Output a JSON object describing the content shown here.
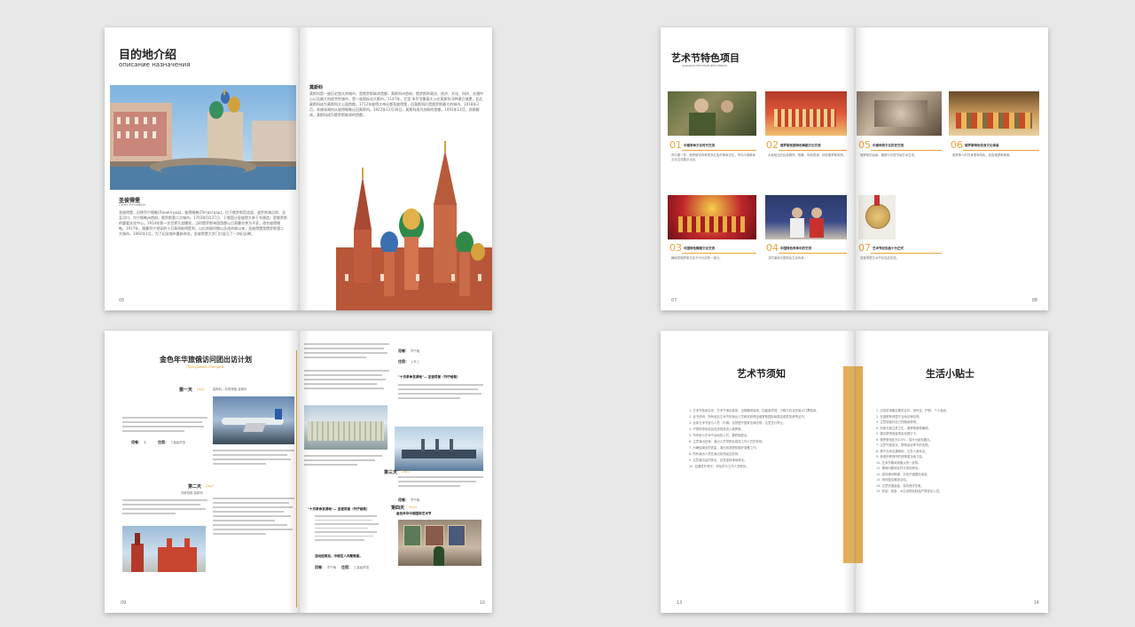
{
  "spread1": {
    "left": {
      "title": "目的地介绍",
      "subtitle": "описание назначения",
      "caption_title": "圣彼得堡",
      "caption_sub": "Санкт-Петербург",
      "body": "圣彼得堡，旧称列宁格勒(Ленинград)，彼得格勒(Петроград)，位于俄罗斯西北部，波罗的海沿岸，涅瓦河口，列宁格勒州首府，俄罗斯第二大城市。1703年5月27日，于俄国沙皇彼得大帝下令建造，是俄罗斯的重要文化中心。1914年第一次世界大战爆发，当时俄罗斯帝国首都以日耳曼名称为不妥，改名彼得格勒。1917年，随着列宁领导的十月革命取得胜利，以后苏联时期以及改苏联以来，圣彼得堡是俄罗斯第二大城市。1992年1月，为了纪念城市重新命名，圣彼得堡大学门口竖立了一块纪念碑。",
      "page_num": "05"
    },
    "right": {
      "heading": "莫斯科",
      "body": "莫斯科是一座历史悠久的城市，是俄罗斯联邦首都、莫斯科州首府，俄罗斯的政治、经济、文化、科技、交通中心以及最大的综合性城市，是一座国际化大都市。1147年，尤里·多尔戈鲁基大公在莫斯科河畔建立城堡，此后莫斯科成为莫斯科大公国首都。1712年彼得大帝迁都圣彼得堡，但莫斯科仍是俄罗斯最大的城市。1918年3月，苏维埃政府从彼得格勒迁回莫斯科。1922年12月30日，莫斯科成为苏联的首都。1991年12月，苏联解体，莫斯科成为俄罗斯联邦的首都。",
      "page_num": "06"
    }
  },
  "spread2": {
    "left": {
      "title": "艺术节特色项目",
      "subtitle": "художественный фестиваль",
      "items": [
        {
          "num": "01",
          "title": "中俄革命文化时代交流",
          "desc": "同中国一样，俄罗斯也有着很多红色的革命记忆。举办中俄革命文化交流展示活动。"
        },
        {
          "num": "02",
          "title": "俄罗斯民族特色舞蹈文化交流",
          "desc": "大家相互的民族服饰、歌舞、特色表演，体验俄罗斯风情。"
        },
        {
          "num": "03",
          "title": "中国特色舞蹈文化交流",
          "desc": "舞蹈是俄罗斯文化不可分割的一部分。"
        },
        {
          "num": "04",
          "title": "中国特色传承中的交流",
          "desc": "共同演绎中国特色文化传承。"
        }
      ],
      "page_num": "07"
    },
    "right": {
      "items": [
        {
          "num": "05",
          "title": "中俄传统文化历史交流",
          "desc": "俄罗斯的油画、雕塑与中国书画艺术交流。"
        },
        {
          "num": "06",
          "title": "俄罗斯特色饮食文化体验",
          "desc": "俄罗斯人的饮食很有特色，品尝俄罗斯美食。"
        },
        {
          "num": "07",
          "title": "艺术节纪念品十分正式",
          "desc": "圣彼得堡艺术节纪念品发放。"
        }
      ],
      "page_num": "08"
    }
  },
  "spread3": {
    "left": {
      "title": "金色年华旅俄访问团出访计划",
      "subtitle": "Программа поездки",
      "day1": "第一天",
      "day1_en": "Day1",
      "day1_route": "莫斯科—苏联首都·莫斯科",
      "meal_label": "用餐：",
      "meal_val": "无",
      "stay_label": "住宿：",
      "stay_val": "三星级宾馆",
      "day2": "第二天",
      "day2_en": "Day2",
      "day2_route": "苏联首都·莫斯科",
      "page_num": "09"
    },
    "right": {
      "meal_label": "用餐：",
      "meal_val": "早午晚",
      "stay_label": "住宿：",
      "stay_val": "火车上",
      "highlight1": "\"十月革命发源地\"— 圣彼得堡（列宁格勒）",
      "day3": "第三天",
      "day3_en": "Day3",
      "highlight2": "\"十月革命发源地\"— 圣彼得堡（列宁格勒）",
      "notice": "活动结束后，中俄友人共聚晚宴。",
      "day4": "第四天",
      "day4_en": "Day4",
      "day4_title": "金色年华中俄国际艺术节",
      "stay_val2": "三星级宾馆",
      "page_num": "10"
    }
  },
  "spread4": {
    "left": {
      "title": "艺术节须知",
      "items": [
        "1. 艺术节费用包含：艺术节演出费用、全程翻译费用、四星级宾馆、行程中包含的景点门票费用。",
        "2. 证书说明：所有参加艺术节的演出人员都将获得由俄罗斯国际组委会颁发的荣誉证书。",
        "3. 全体艺术节参与人员（中俄）自觉遵守国家法律法规，注意言行举止。",
        "4. 严禁携带危险品及违禁品进入俄罗斯。",
        "5. 所有参与艺术节活动的人员，要积极配合。",
        "6. 注意演出纪律，演出人员须配合现场工作人员的安排。",
        "7. 为确保演出的质量，演出前请提前做好准备工作。",
        "8. 所有演出人员在演出前须经过彩排。",
        "9. 注意演出后的安全，自觉保持场地清洁。",
        "10. 如遇意外情况，请及时与工作人员联系。"
      ],
      "page_num": "13"
    },
    "right": {
      "title": "生活小贴士",
      "items": [
        "1. 出发前请备必要的证件、身份证、护照、个人用品。",
        "2. 在俄罗斯请遵守当地法律法规。",
        "3. 注意保管好自己的随身财物。",
        "4. 饮食方面注意卫生，俄罗斯食物偏咸。",
        "5. 建议携带适量现金及银行卡。",
        "6. 俄罗斯电压为220V，插头为欧标圆孔。",
        "7. 注意气候变化，携带适合季节的衣物。",
        "8. 遵守当地交通规则，注意人身安全。",
        "9. 参观宗教场所时请尊重当地习俗。",
        "10. 艺术节期间请服从统一安排。",
        "11. 遇到问题请及时与领队联系。",
        "12. 保持通讯畅通，手机开通国际漫游。",
        "13. 请勿擅自离团活动。",
        "14. 注意饮酒适量，保持良好形象。",
        "15. 药品、零食、水生动物及制品严禁带出入境。"
      ],
      "page_num": "14"
    }
  },
  "colors": {
    "accent": "#e8a33a",
    "background": "#e8e8e8",
    "page": "#ffffff"
  }
}
